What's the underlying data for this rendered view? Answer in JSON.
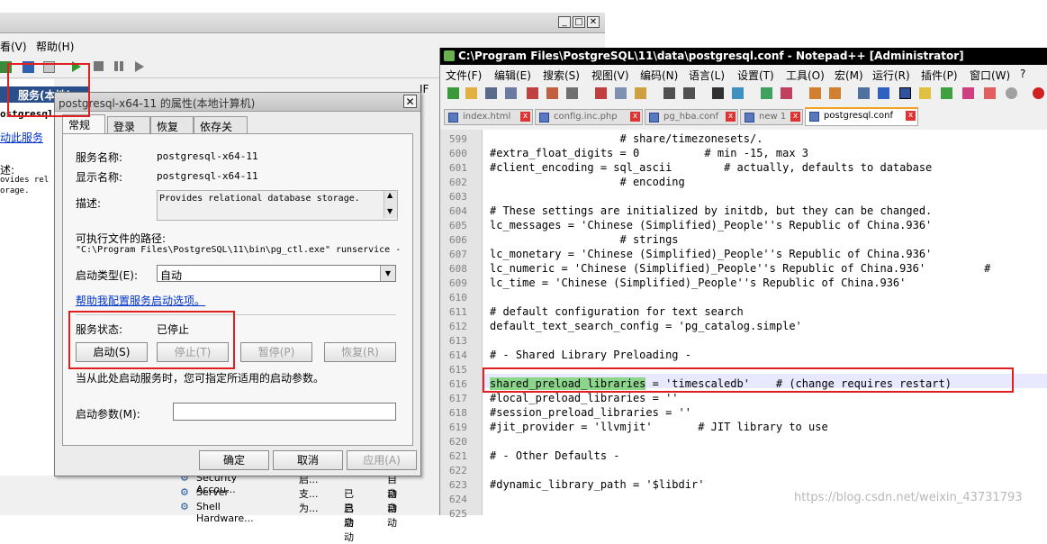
{
  "services_window": {
    "menu": [
      "看(V)",
      "帮助(H)"
    ],
    "header": "服务(本地)",
    "left_items": [
      "ostgresql",
      "动此服务",
      "述:",
      "ovides rel",
      "orage."
    ],
    "rows": [
      {
        "name": "Security Accou...",
        "desc": "启...",
        "status": "",
        "startup": "自动"
      },
      {
        "name": "Server",
        "desc": "支...",
        "status": "已启动",
        "startup": "自动"
      },
      {
        "name": "Shell Hardware...",
        "desc": "为...",
        "status": "已启动",
        "startup": "自动"
      }
    ]
  },
  "dialog": {
    "title": "postgresql-x64-11 的属性(本地计算机)",
    "close": "✕",
    "tabs": [
      "常规",
      "登录",
      "恢复",
      "依存关系"
    ],
    "service_name_label": "服务名称:",
    "service_name": "postgresql-x64-11",
    "display_name_label": "显示名称:",
    "display_name": "postgresql-x64-11",
    "desc_label": "描述:",
    "desc": "Provides relational database storage.",
    "path_label": "可执行文件的路径:",
    "path": "\"C:\\Program Files\\PostgreSQL\\11\\bin\\pg_ctl.exe\" runservice -",
    "startup_label": "启动类型(E):",
    "startup_value": "自动",
    "help_link": "帮助我配置服务启动选项。",
    "status_label": "服务状态:",
    "status_value": "已停止",
    "start": "启动(S)",
    "stop": "停止(T)",
    "pause": "暂停(P)",
    "resume": "恢复(R)",
    "hint": "当从此处启动服务时，您可指定所适用的启动参数。",
    "params_label": "启动参数(M):",
    "params_value": "",
    "ok": "确定",
    "cancel": "取消",
    "apply": "应用(A)"
  },
  "notepad": {
    "title": "C:\\Program Files\\PostgreSQL\\11\\data\\postgresql.conf - Notepad++ [Administrator]",
    "menu": [
      "文件(F)",
      "编辑(E)",
      "搜索(S)",
      "视图(V)",
      "编码(N)",
      "语言(L)",
      "设置(T)",
      "工具(O)",
      "宏(M)",
      "运行(R)",
      "插件(P)",
      "窗口(W)",
      "?"
    ],
    "tabs": [
      "index.html",
      "config.inc.php",
      "pg_hba.conf",
      "new 1",
      "postgresql.conf"
    ],
    "lines": [
      {
        "n": "599",
        "text": "                    # share/timezonesets/."
      },
      {
        "n": "600",
        "text": "#extra_float_digits = 0          # min -15, max 3"
      },
      {
        "n": "601",
        "text": "#client_encoding = sql_ascii        # actually, defaults to database"
      },
      {
        "n": "602",
        "text": "                    # encoding"
      },
      {
        "n": "603",
        "text": ""
      },
      {
        "n": "604",
        "text": "# These settings are initialized by initdb, but they can be changed."
      },
      {
        "n": "605",
        "text": "lc_messages = 'Chinese (Simplified)_People''s Republic of China.936'"
      },
      {
        "n": "606",
        "text": "                    # strings"
      },
      {
        "n": "607",
        "text": "lc_monetary = 'Chinese (Simplified)_People''s Republic of China.936'"
      },
      {
        "n": "608",
        "text": "lc_numeric = 'Chinese (Simplified)_People''s Republic of China.936'         #"
      },
      {
        "n": "609",
        "text": "lc_time = 'Chinese (Simplified)_People''s Republic of China.936'"
      },
      {
        "n": "610",
        "text": ""
      },
      {
        "n": "611",
        "text": "# default configuration for text search"
      },
      {
        "n": "612",
        "text": "default_text_search_config = 'pg_catalog.simple'"
      },
      {
        "n": "613",
        "text": ""
      },
      {
        "n": "614",
        "text": "# - Shared Library Preloading -"
      },
      {
        "n": "615",
        "text": ""
      },
      {
        "n": "616",
        "text": " = 'timescaledb'    # (change requires restart)",
        "highlight": "shared_preload_libraries"
      },
      {
        "n": "617",
        "text": "#local_preload_libraries = ''"
      },
      {
        "n": "618",
        "text": "#session_preload_libraries = ''"
      },
      {
        "n": "619",
        "text": "#jit_provider = 'llvmjit'       # JIT library to use"
      },
      {
        "n": "620",
        "text": ""
      },
      {
        "n": "621",
        "text": "# - Other Defaults -"
      },
      {
        "n": "622",
        "text": ""
      },
      {
        "n": "623",
        "text": "#dynamic_library_path = '$libdir'"
      },
      {
        "n": "624",
        "text": ""
      },
      {
        "n": "625",
        "text": ""
      }
    ]
  },
  "watermark": "https://blog.csdn.net/weixin_43731793"
}
